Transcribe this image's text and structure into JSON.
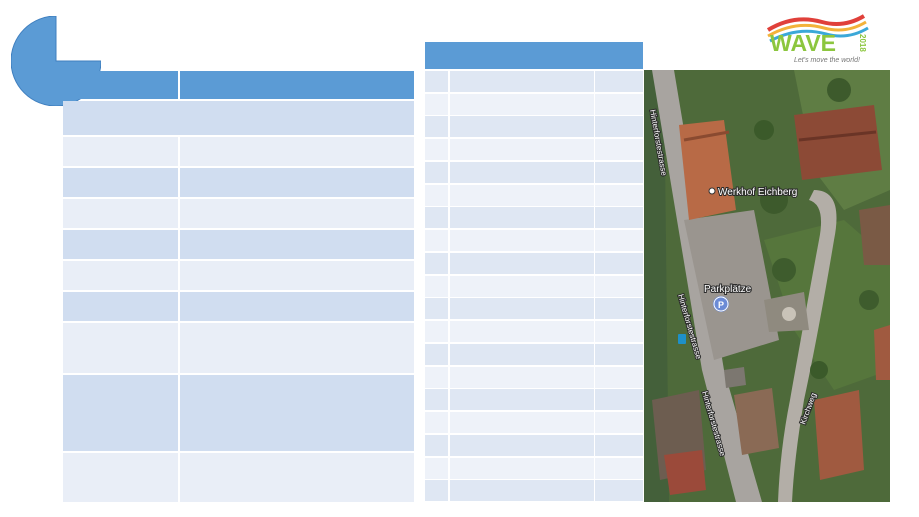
{
  "logo": {
    "word": "WAVE",
    "year": "2018",
    "tagline": "Let's move the world!"
  },
  "map": {
    "place_label": "Werkhof Eichberg",
    "parking_label": "Parkplätze",
    "parking_icon": "P",
    "street_upper": "Hinterforstestrasse",
    "street_middle": "Hinterforstestrasse",
    "street_lower": "Hinterforstestrasse",
    "side_street": "Kirchweg"
  },
  "colors": {
    "accent": "#5b9bd5",
    "row_dark": "#d0ddf0",
    "row_light": "#e9eef7"
  }
}
